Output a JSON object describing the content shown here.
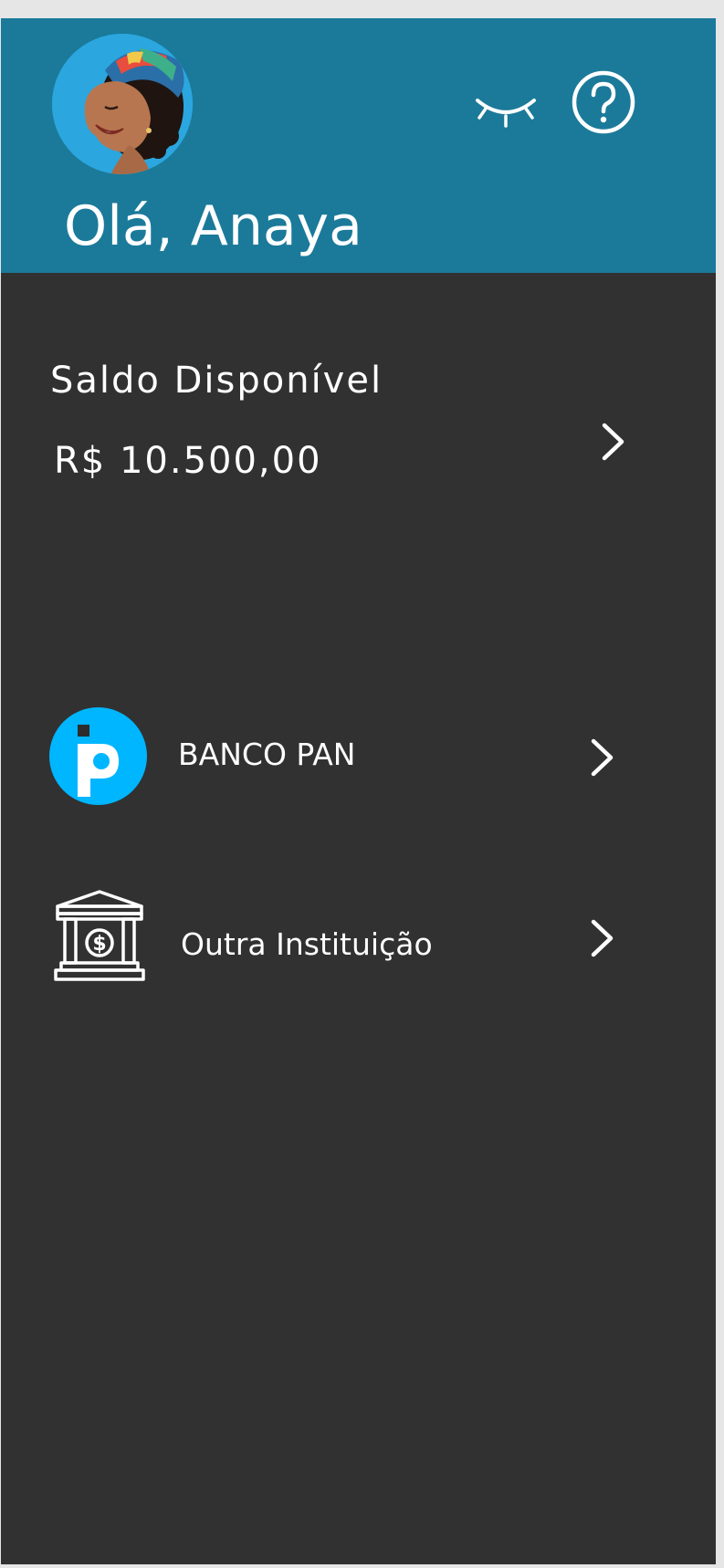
{
  "header": {
    "greeting": "Olá, Anaya",
    "avatar_alt": "user-photo",
    "hide_balance_icon": "closed-eye-icon",
    "help_icon": "help-circle-icon"
  },
  "balance": {
    "label": "Saldo Disponível",
    "value": "R$ 10.500,00",
    "chevron_icon": "chevron-right-icon"
  },
  "options": [
    {
      "label": "BANCO PAN",
      "icon": "banco-pan-logo",
      "chevron_icon": "chevron-right-icon"
    },
    {
      "label": "Outra Instituição",
      "icon": "bank-building-icon",
      "chevron_icon": "chevron-right-icon"
    }
  ],
  "colors": {
    "header_bg": "#1b7a9a",
    "body_bg": "#313131",
    "pan_blue": "#00b6ff",
    "text": "#ffffff"
  }
}
